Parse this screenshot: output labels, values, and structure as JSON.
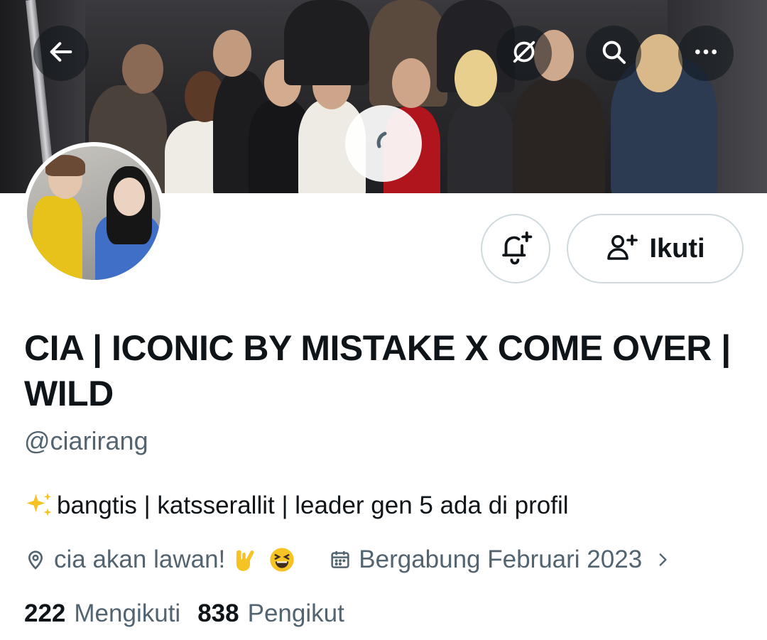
{
  "profile": {
    "display_name": "CIA | ICONIC BY MISTAKE X COME OVER | WILD",
    "handle": "@ciarirang",
    "bio": {
      "emoji_icon": "sparkles-icon",
      "text": "bangtis | katsserallit | leader gen 5 ada di profil"
    },
    "location": {
      "text": "cia akan lawan!",
      "emoji_icons": [
        "rock-on-hand-icon",
        "grinning-squinting-face-icon"
      ]
    },
    "joined": "Bergabung Februari 2023"
  },
  "actions": {
    "follow_label": "Ikuti",
    "bell_icon": "bell-plus-icon"
  },
  "header_icons": [
    "back-arrow-icon",
    "translate-icon",
    "search-icon",
    "more-icon"
  ],
  "stats": {
    "following_count": "222",
    "following_label": "Mengikuti",
    "followers_count": "838",
    "followers_label": "Pengikut"
  },
  "colors": {
    "text_primary": "#0f1419",
    "text_secondary": "#536471",
    "border": "#cfd9de"
  }
}
